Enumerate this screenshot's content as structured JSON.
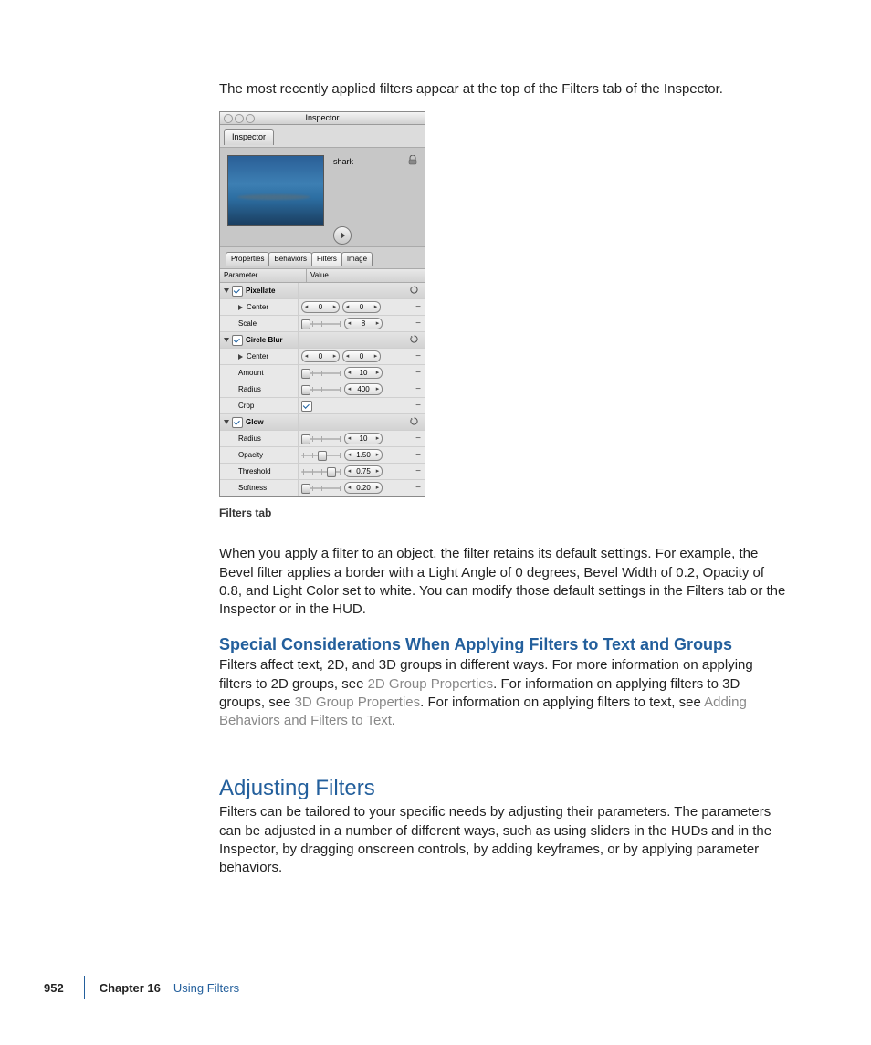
{
  "body": {
    "p1": "The most recently applied filters appear at the top of the Filters tab of the Inspector.",
    "caption": "Filters tab",
    "p2": "When you apply a filter to an object, the filter retains its default settings. For example, the Bevel filter applies a border with a Light Angle of 0 degrees, Bevel Width of 0.2, Opacity of 0.8, and Light Color set to white. You can modify those default settings in the Filters tab or the Inspector or in the HUD.",
    "sub1": "Special Considerations When Applying Filters to Text and Groups",
    "p3a": "Filters affect text, 2D, and 3D groups in different ways. For more information on applying filters to 2D groups, see ",
    "link1": "2D Group Properties",
    "p3b": ". For information on applying filters to 3D groups, see ",
    "link2": "3D Group Properties",
    "p3c": ". For information on applying filters to text, see ",
    "link3": "Adding Behaviors and Filters to Text",
    "p3d": ".",
    "h2": "Adjusting Filters",
    "p4": "Filters can be tailored to your specific needs by adjusting their parameters. The parameters can be adjusted in a number of different ways, such as using sliders in the HUDs and in the Inspector, by dragging onscreen controls, by adding keyframes, or by applying parameter behaviors."
  },
  "footer": {
    "page": "952",
    "chapter_label": "Chapter 16",
    "chapter_name": "Using Filters"
  },
  "inspector": {
    "window_title": "Inspector",
    "main_tab": "Inspector",
    "object_name": "shark",
    "subtabs": [
      "Properties",
      "Behaviors",
      "Filters",
      "Image"
    ],
    "header_param": "Parameter",
    "header_value": "Value",
    "groups": [
      {
        "name": "Pixellate",
        "rows": [
          {
            "label": "Center",
            "type": "dualspin",
            "v1": "0",
            "v2": "0"
          },
          {
            "label": "Scale",
            "type": "slider_spin",
            "spin": "8"
          }
        ]
      },
      {
        "name": "Circle Blur",
        "rows": [
          {
            "label": "Center",
            "type": "dualspin",
            "v1": "0",
            "v2": "0"
          },
          {
            "label": "Amount",
            "type": "slider_spin",
            "spin": "10"
          },
          {
            "label": "Radius",
            "type": "slider_spin",
            "spin": "400"
          },
          {
            "label": "Crop",
            "type": "check"
          }
        ]
      },
      {
        "name": "Glow",
        "rows": [
          {
            "label": "Radius",
            "type": "slider_spin",
            "spin": "10"
          },
          {
            "label": "Opacity",
            "type": "slider_spin",
            "spin": "1.50"
          },
          {
            "label": "Threshold",
            "type": "slider_spin",
            "spin": "0.75"
          },
          {
            "label": "Softness",
            "type": "slider_spin",
            "spin": "0.20"
          }
        ]
      }
    ]
  }
}
